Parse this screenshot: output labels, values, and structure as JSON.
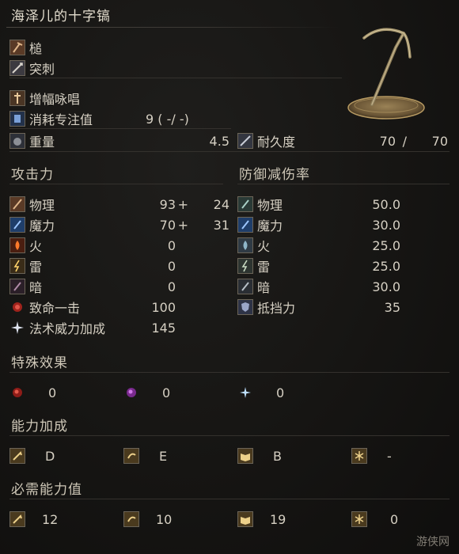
{
  "title": "海泽儿的十字镐",
  "attack_types": [
    "槌",
    "突刺"
  ],
  "skill": "增幅咏唱",
  "fp_cost": {
    "label": "消耗专注值",
    "value": "9 (  -/  -)"
  },
  "weight": {
    "label": "重量",
    "value": "4.5"
  },
  "durability": {
    "label": "耐久度",
    "current": "70",
    "sep": "/",
    "max": "70"
  },
  "attack": {
    "header": "攻击力",
    "rows": [
      {
        "label": "物理",
        "base": "93",
        "plus": "+",
        "bonus": "24"
      },
      {
        "label": "魔力",
        "base": "70",
        "plus": "+",
        "bonus": "31"
      },
      {
        "label": "火",
        "base": "0",
        "plus": "",
        "bonus": ""
      },
      {
        "label": "雷",
        "base": "0",
        "plus": "",
        "bonus": ""
      },
      {
        "label": "暗",
        "base": "0",
        "plus": "",
        "bonus": ""
      },
      {
        "label": "致命一击",
        "base": "100",
        "plus": "",
        "bonus": ""
      },
      {
        "label": "法术威力加成",
        "base": "145",
        "plus": "",
        "bonus": ""
      }
    ]
  },
  "defense": {
    "header": "防御减伤率",
    "rows": [
      {
        "label": "物理",
        "value": "50.0"
      },
      {
        "label": "魔力",
        "value": "30.0"
      },
      {
        "label": "火",
        "value": "25.0"
      },
      {
        "label": "雷",
        "value": "25.0"
      },
      {
        "label": "暗",
        "value": "30.0"
      },
      {
        "label": "抵挡力",
        "value": "35"
      }
    ]
  },
  "effects": {
    "header": "特殊效果",
    "values": [
      "0",
      "0",
      "0"
    ]
  },
  "scaling": {
    "header": "能力加成",
    "values": [
      "D",
      "E",
      "B",
      "-"
    ]
  },
  "requirements": {
    "header": "必需能力值",
    "values": [
      "12",
      "10",
      "19",
      "0"
    ]
  },
  "watermark": "游侠网",
  "colors": {
    "icon_border": "#6b6457",
    "text": "#d6d0c3",
    "bg": "#141312"
  }
}
